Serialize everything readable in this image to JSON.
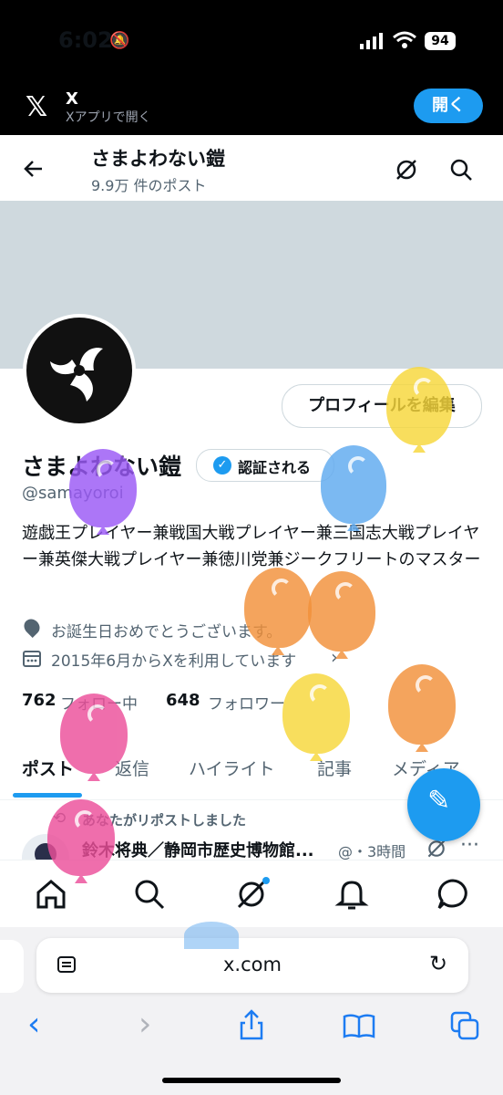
{
  "status_bar": {
    "time": "6:02",
    "battery": "94"
  },
  "app_banner": {
    "app_name": "X",
    "subtitle": "Xアプリで開く",
    "open_label": "開く"
  },
  "header": {
    "title": "さまよわない鎧",
    "post_count": "9.9万 件のポスト"
  },
  "profile": {
    "name": "さまよわない鎧",
    "verify_label": "認証される",
    "handle": "@samayoroi",
    "edit_label": "プロフィールを編集",
    "bio": "遊戯王プレイヤー兼戦国大戦プレイヤー兼三国志大戦プレイヤー兼英傑大戦プレイヤー兼徳川党兼ジークフリートのマスター",
    "location": "お誕生日おめでとうございます。",
    "joined": "2015年6月からXを利用しています",
    "following_count": "762",
    "following_label": "フォロー中",
    "followers_count": "648",
    "followers_label": "フォロワー"
  },
  "tabs": [
    "ポスト",
    "返信",
    "ハイライト",
    "記事",
    "メディア"
  ],
  "timeline": {
    "repost_label": "あなたがリポストしました",
    "author": "鈴木将典／静岡市歴史博物館...",
    "meta": "@・3時間"
  },
  "browser": {
    "url": "x.com"
  },
  "colors": {
    "accent": "#1d9bf0",
    "banner": "#cfd9de"
  }
}
